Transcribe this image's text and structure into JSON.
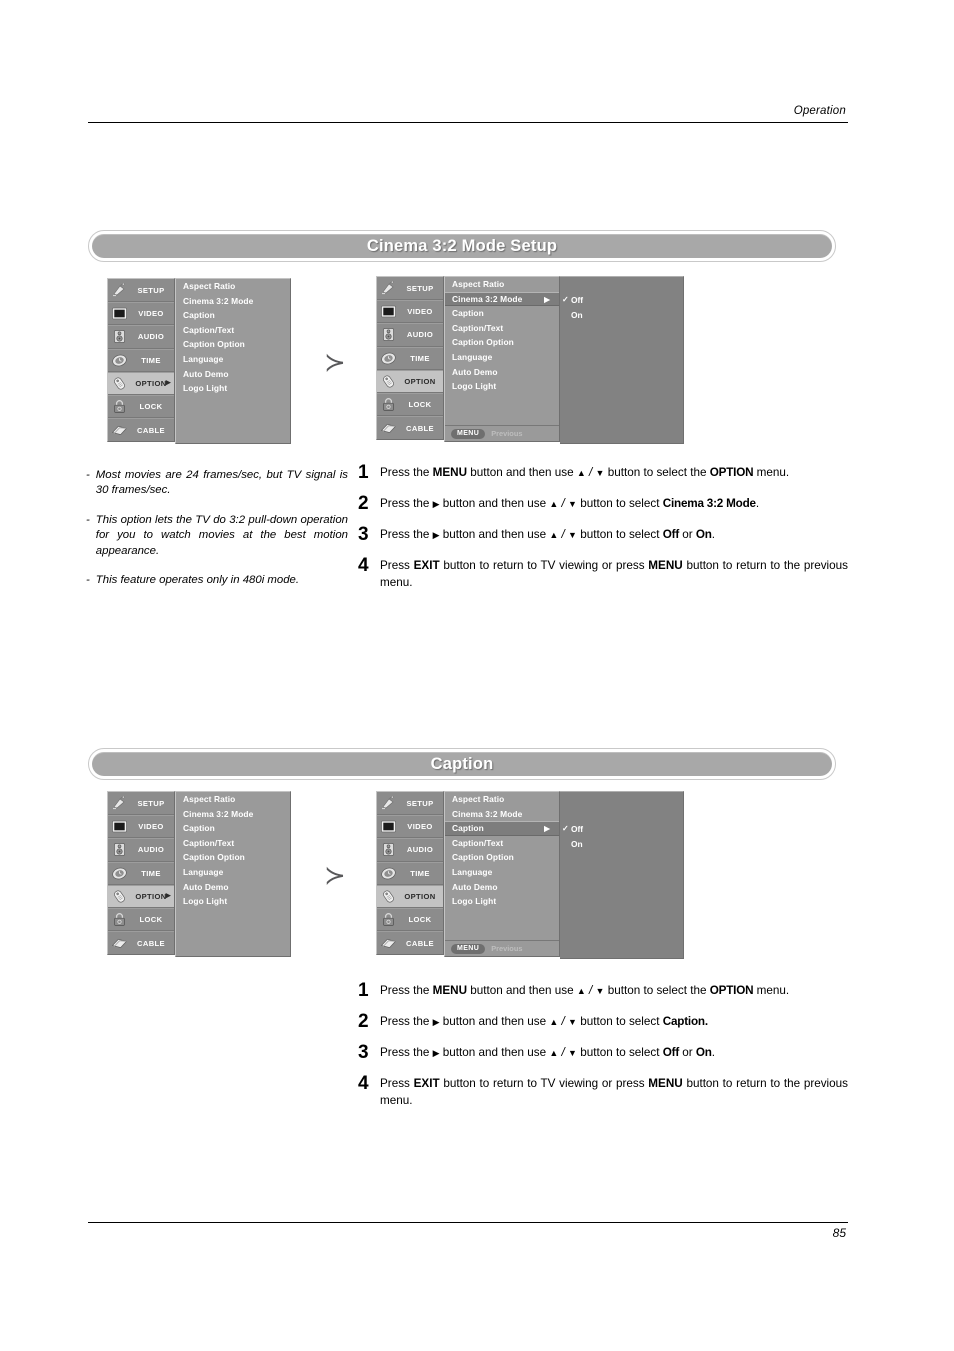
{
  "page": {
    "header_label": "Operation",
    "page_number": "85"
  },
  "osd_sidebar": [
    {
      "label": "SETUP",
      "icon": "satellite-dish-icon"
    },
    {
      "label": "VIDEO",
      "icon": "tv-screen-icon"
    },
    {
      "label": "AUDIO",
      "icon": "speaker-icon"
    },
    {
      "label": "TIME",
      "icon": "clock-icon"
    },
    {
      "label": "OPTION",
      "icon": "tag-icon",
      "active": true,
      "arrow": "▶"
    },
    {
      "label": "LOCK",
      "icon": "padlock-icon"
    },
    {
      "label": "CABLE",
      "icon": "cable-icon"
    }
  ],
  "osd_menu_items": [
    "Aspect Ratio",
    "Cinema 3:2 Mode",
    "Caption",
    "Caption/Text",
    "Caption Option",
    "Language",
    "Auto Demo",
    "Logo Light"
  ],
  "osd_footer": {
    "menu_button": "MENU",
    "previous_label": "Previous"
  },
  "osd_submenu": {
    "check": "✓",
    "options": [
      "Off",
      "On"
    ],
    "selected": "Off"
  },
  "flow_arrow_glyph": "≻",
  "sections": [
    {
      "title": "Cinema 3:2 Mode Setup",
      "selected_menu_item": "Cinema 3:2 Mode",
      "submenu_arrow": "▶",
      "notes": [
        "Most movies are 24 frames/sec, but TV signal is 30 frames/sec.",
        "This option lets the TV do 3:2 pull-down operation for you to watch movies at the best motion appearance.",
        "This feature operates only in 480i mode."
      ],
      "steps": [
        {
          "num": "1",
          "html": "Press the <b>MENU</b> button and then use <span class=\"tri\">▲</span> <i>/</i> <span class=\"tri\">▼</span> button to select the <b class=\"tight\">OPTION</b> menu."
        },
        {
          "num": "2",
          "html": "Press the <span class=\"tri\">▶</span> button and then use <span class=\"tri\">▲</span> <i>/</i> <span class=\"tri\">▼</span> button to select <b class=\"tight\">Cinema 3:2 Mode</b>."
        },
        {
          "num": "3",
          "html": "Press the <span class=\"tri\">▶</span> button and then use <span class=\"tri\">▲</span> <i>/</i> <span class=\"tri\">▼</span> button to select <b class=\"tight\">Off</b> or <b class=\"tight\">On</b>."
        },
        {
          "num": "4",
          "html": "Press <b>EXIT</b> button to return to TV viewing or press <b>MENU</b> button to return to the previous menu."
        }
      ]
    },
    {
      "title": "Caption",
      "selected_menu_item": "Caption",
      "submenu_arrow": "▶",
      "notes": [],
      "steps": [
        {
          "num": "1",
          "html": "Press the <b>MENU</b> button and then use <span class=\"tri\">▲</span> <i>/</i> <span class=\"tri\">▼</span> button to select the <b class=\"tight\">OPTION</b> menu."
        },
        {
          "num": "2",
          "html": "Press the <span class=\"tri\">▶</span> button and then use <span class=\"tri\">▲</span> <i>/</i> <span class=\"tri\">▼</span> button to select <b class=\"tight\">Caption.</b>"
        },
        {
          "num": "3",
          "html": "Press the <span class=\"tri\">▶</span> button and then use <span class=\"tri\">▲</span> <i>/</i> <span class=\"tri\">▼</span> button to select <b class=\"tight\">Off</b> or <b class=\"tight\">On</b>."
        },
        {
          "num": "4",
          "html": "Press <b>EXIT</b> button to return to TV viewing or press <b>MENU</b> button to return to the previous menu."
        }
      ]
    }
  ],
  "colors": {
    "pill_fill": "#a8a8a8",
    "osd_sidebar_bg": "#8c8c8c",
    "osd_list_bg": "#9a9a9a",
    "osd_selected_row": "#7d7d7d",
    "osd_submenu_bg": "#828282",
    "sidebar_active": "#c3c3c3"
  }
}
